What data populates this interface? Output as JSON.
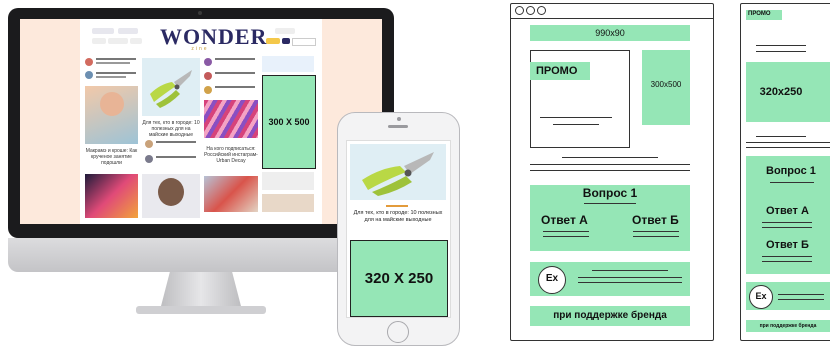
{
  "desktop": {
    "site_logo": "WONDER",
    "site_logo_sub": "zine",
    "ad_label": "300 X 500",
    "article_title": "Для тех, кто в городе: 10 полезных для на майские выходные",
    "article_title_2": "Макрамэ и кроше: Как крученое занятие подошли",
    "article_title_3": "На кого подписаться: Российский инстаграм-Urban Decay"
  },
  "mobile": {
    "ad_label": "320 X 250",
    "article_title": "Для тех, кто в городе: 10 полезных для на майские выходные"
  },
  "wireframe_desktop": {
    "banner_label": "990x90",
    "promo_label": "ПРОМО",
    "side_ad_label": "300x500",
    "quiz_question": "Вопрос 1",
    "answer_a": "Ответ А",
    "answer_b": "Ответ Б",
    "badge": "Ex",
    "brand_note": "при поддержке бренда"
  },
  "wireframe_mobile": {
    "promo_label": "ПРОМО",
    "ad_label": "320x250",
    "quiz_question": "Вопрос 1",
    "answer_a": "Ответ А",
    "answer_b": "Ответ Б",
    "badge": "Ex",
    "brand_note": "при поддержке бренда"
  },
  "colors": {
    "accent_green": "#95e6b6",
    "navy": "#2b2a63",
    "peach": "#fde9dc"
  }
}
